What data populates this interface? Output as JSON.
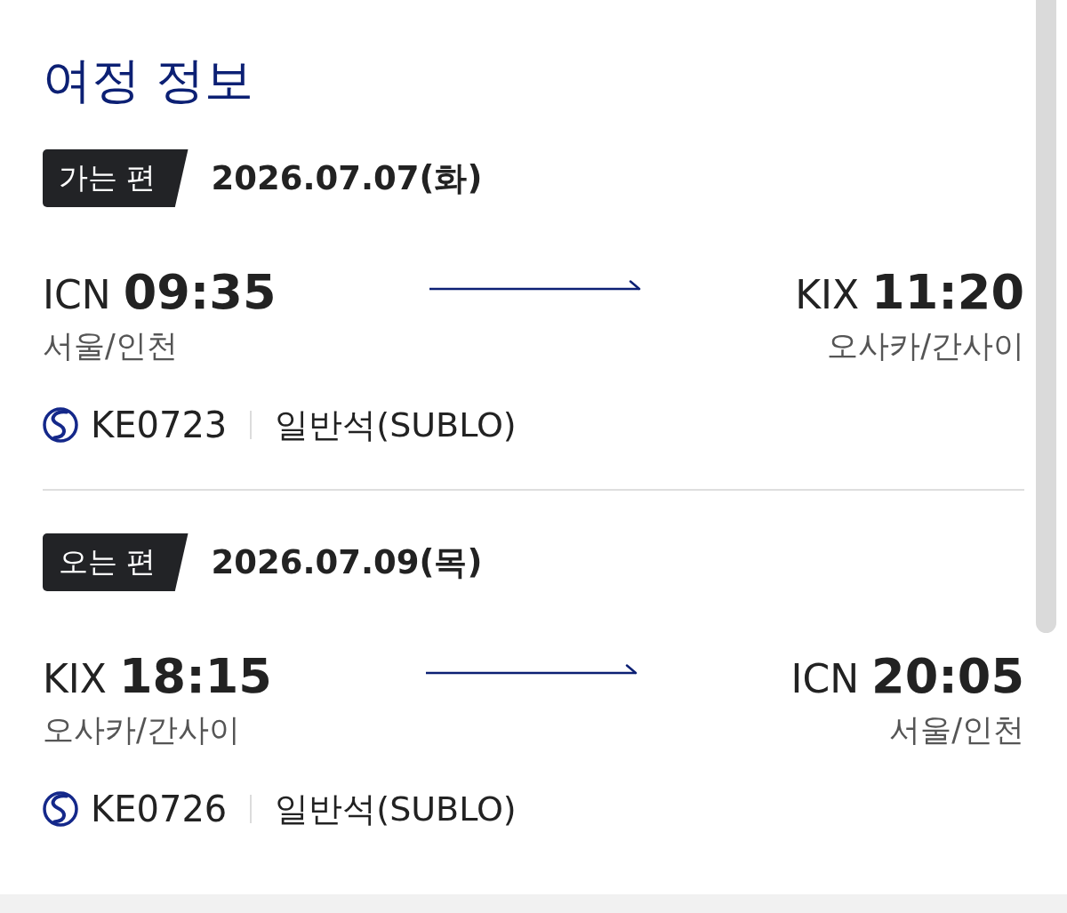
{
  "page_title": "여정 정보",
  "segments": [
    {
      "label": "가는 편",
      "date": "2026.07.07(화)",
      "departure": {
        "code": "ICN",
        "time": "09:35",
        "city": "서울/인천"
      },
      "arrival": {
        "code": "KIX",
        "time": "11:20",
        "city": "오사카/간사이"
      },
      "flight_number": "KE0723",
      "cabin": "일반석(SUBLO)"
    },
    {
      "label": "오는 편",
      "date": "2026.07.09(목)",
      "departure": {
        "code": "KIX",
        "time": "18:15",
        "city": "오사카/간사이"
      },
      "arrival": {
        "code": "ICN",
        "time": "20:05",
        "city": "서울/인천"
      },
      "flight_number": "KE0726",
      "cabin": "일반석(SUBLO)"
    }
  ]
}
